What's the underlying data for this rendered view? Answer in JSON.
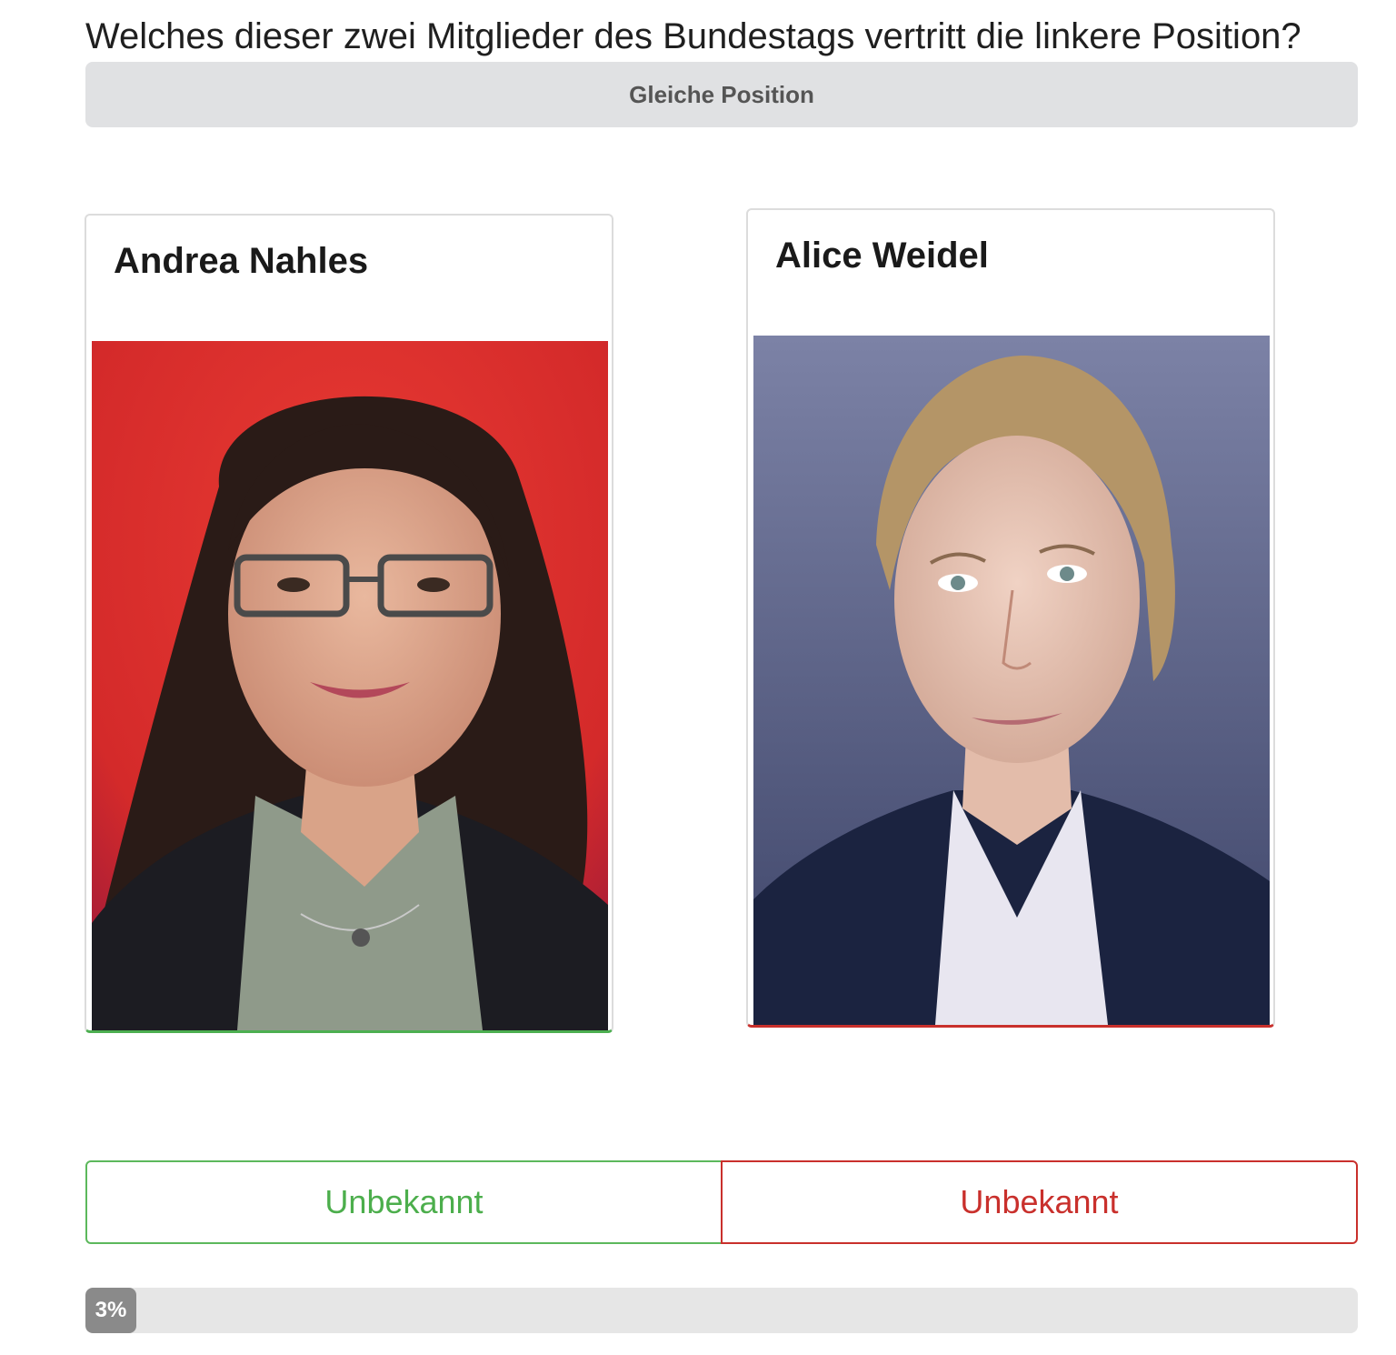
{
  "question": "Welches dieser zwei Mitglieder des Bundestags vertritt die linkere Position?",
  "same_position_label": "Gleiche Position",
  "left_card": {
    "name": "Andrea Nahles",
    "photo_alt": "Andrea Nahles",
    "accent": "#4caf50"
  },
  "right_card": {
    "name": "Alice Weidel",
    "photo_alt": "Alice Weidel",
    "accent": "#c9302c"
  },
  "answers": {
    "left_label": "Unbekannt",
    "right_label": "Unbekannt",
    "left_color": "#4cae4c",
    "right_color": "#c9302c"
  },
  "progress": {
    "percent": 3,
    "label": "3%"
  }
}
